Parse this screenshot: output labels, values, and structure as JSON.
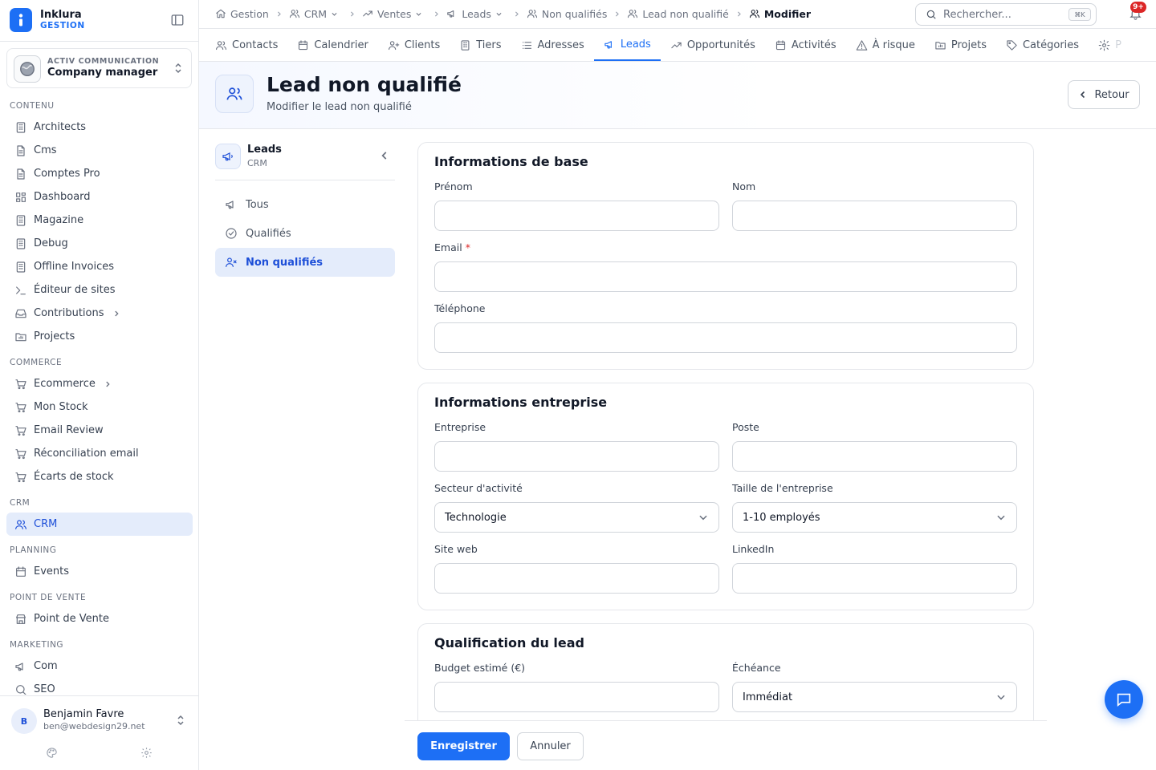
{
  "app": {
    "name": "Inklura",
    "sub": "GESTION"
  },
  "company": {
    "sub": "ACTIV COMMUNICATION",
    "name": "Company manager"
  },
  "sidebar": {
    "sections": [
      {
        "title": "CONTENU",
        "items": [
          {
            "label": "Architects",
            "icon": "building"
          },
          {
            "label": "Cms",
            "icon": "doc"
          },
          {
            "label": "Comptes Pro",
            "icon": "doc"
          },
          {
            "label": "Dashboard",
            "icon": "grid"
          },
          {
            "label": "Magazine",
            "icon": "building"
          },
          {
            "label": "Debug",
            "icon": "building"
          },
          {
            "label": "Offline Invoices",
            "icon": "building"
          },
          {
            "label": "Éditeur de sites",
            "icon": "terminal"
          },
          {
            "label": "Contributions",
            "icon": "inbox",
            "expandable": true
          },
          {
            "label": "Projects",
            "icon": "folder"
          }
        ]
      },
      {
        "title": "COMMERCE",
        "items": [
          {
            "label": "Ecommerce",
            "icon": "cart",
            "expandable": true
          },
          {
            "label": "Mon Stock",
            "icon": "cart"
          },
          {
            "label": "Email Review",
            "icon": "cart"
          },
          {
            "label": "Réconciliation email",
            "icon": "cart"
          },
          {
            "label": "Écarts de stock",
            "icon": "cart"
          }
        ]
      },
      {
        "title": "CRM",
        "items": [
          {
            "label": "CRM",
            "icon": "users",
            "active": true
          }
        ]
      },
      {
        "title": "PLANNING",
        "items": [
          {
            "label": "Events",
            "icon": "calendar"
          }
        ]
      },
      {
        "title": "POINT DE VENTE",
        "items": [
          {
            "label": "Point de Vente",
            "icon": "store"
          }
        ]
      },
      {
        "title": "MARKETING",
        "items": [
          {
            "label": "Com",
            "icon": "megaphone"
          },
          {
            "label": "SEO",
            "icon": "search"
          }
        ]
      }
    ]
  },
  "user": {
    "initial": "B",
    "name": "Benjamin Favre",
    "email": "ben@webdesign29.net"
  },
  "breadcrumb": [
    {
      "label": "Gestion",
      "icon": "home",
      "dropdown": false
    },
    {
      "label": "CRM",
      "icon": "users",
      "dropdown": true
    },
    {
      "label": "Ventes",
      "icon": "trend",
      "dropdown": true
    },
    {
      "label": "Leads",
      "icon": "megaphone",
      "dropdown": true
    },
    {
      "label": "Non qualifiés",
      "icon": "users",
      "dropdown": false
    },
    {
      "label": "Lead non qualifié",
      "icon": "users",
      "dropdown": false
    },
    {
      "label": "Modifier",
      "icon": "users",
      "dropdown": false,
      "current": true
    }
  ],
  "search": {
    "placeholder": "Rechercher...",
    "shortcut": "⌘K"
  },
  "notifications": {
    "badge": "9+"
  },
  "tabs": [
    {
      "label": "Contacts",
      "icon": "users"
    },
    {
      "label": "Calendrier",
      "icon": "calendar"
    },
    {
      "label": "Clients",
      "icon": "user-plus"
    },
    {
      "label": "Tiers",
      "icon": "building"
    },
    {
      "label": "Adresses",
      "icon": "list"
    },
    {
      "label": "Leads",
      "icon": "megaphone",
      "active": true
    },
    {
      "label": "Opportunités",
      "icon": "trend"
    },
    {
      "label": "Activités",
      "icon": "calendar"
    },
    {
      "label": "À risque",
      "icon": "alert"
    },
    {
      "label": "Projets",
      "icon": "folder"
    },
    {
      "label": "Catégories",
      "icon": "tag"
    },
    {
      "label": "P",
      "icon": "gear",
      "faded": true
    }
  ],
  "page": {
    "title": "Lead non qualifié",
    "subtitle": "Modifier le lead non qualifié",
    "back_label": "Retour"
  },
  "subnav": {
    "title": "Leads",
    "subtitle": "CRM",
    "items": [
      {
        "label": "Tous",
        "icon": "megaphone"
      },
      {
        "label": "Qualifiés",
        "icon": "check-circle"
      },
      {
        "label": "Non qualifiés",
        "icon": "user-x",
        "active": true
      }
    ]
  },
  "form": {
    "cards": [
      {
        "title": "Informations de base",
        "rows": [
          [
            {
              "label": "Prénom",
              "value": ""
            },
            {
              "label": "Nom",
              "value": ""
            }
          ],
          [
            {
              "label": "Email",
              "value": "",
              "required": true
            }
          ],
          [
            {
              "label": "Téléphone",
              "value": ""
            }
          ]
        ]
      },
      {
        "title": "Informations entreprise",
        "rows": [
          [
            {
              "label": "Entreprise",
              "value": ""
            },
            {
              "label": "Poste",
              "value": ""
            }
          ],
          [
            {
              "label": "Secteur d'activité",
              "value": "Technologie",
              "select": true
            },
            {
              "label": "Taille de l'entreprise",
              "value": "1-10 employés",
              "select": true
            }
          ],
          [
            {
              "label": "Site web",
              "value": ""
            },
            {
              "label": "LinkedIn",
              "value": ""
            }
          ]
        ]
      },
      {
        "title": "Qualification du lead",
        "rows": [
          [
            {
              "label": "Budget estimé (€)",
              "value": ""
            },
            {
              "label": "Échéance",
              "value": "Immédiat",
              "select": true
            }
          ]
        ]
      }
    ],
    "save_label": "Enregistrer",
    "cancel_label": "Annuler"
  },
  "colors": {
    "accent": "#1d6ff5",
    "active_bg": "#e4ecfb",
    "danger": "#dc2626"
  }
}
